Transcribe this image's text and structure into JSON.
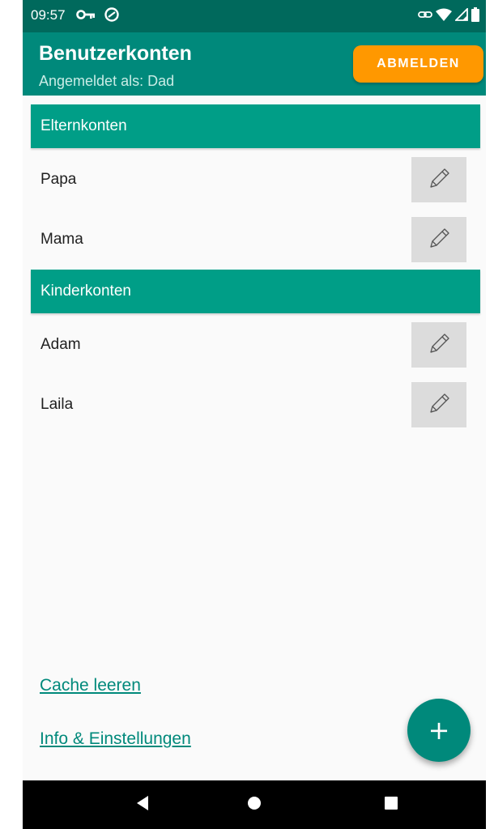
{
  "status_bar": {
    "time": "09:57",
    "left_icons": [
      "vpn-key-icon",
      "data-saver-icon"
    ],
    "right_icons": [
      "link-icon",
      "wifi-icon",
      "signal-icon",
      "battery-icon"
    ]
  },
  "app_bar": {
    "title": "Benutzerkonten",
    "subtitle": "Angemeldet als: Dad",
    "logout_label": "ABMELDEN"
  },
  "sections": [
    {
      "header": "Elternkonten",
      "items": [
        {
          "name": "Papa"
        },
        {
          "name": "Mama"
        }
      ]
    },
    {
      "header": "Kinderkonten",
      "items": [
        {
          "name": "Adam"
        },
        {
          "name": "Laila"
        }
      ]
    }
  ],
  "footer": {
    "clear_cache": "Cache leeren",
    "info_settings": "Info & Einstellungen",
    "fab_label": "+"
  },
  "colors": {
    "status_bar": "#00695c",
    "app_bar": "#00897b",
    "section_header": "#009e87",
    "accent": "#ff9800",
    "link": "#00897b"
  }
}
